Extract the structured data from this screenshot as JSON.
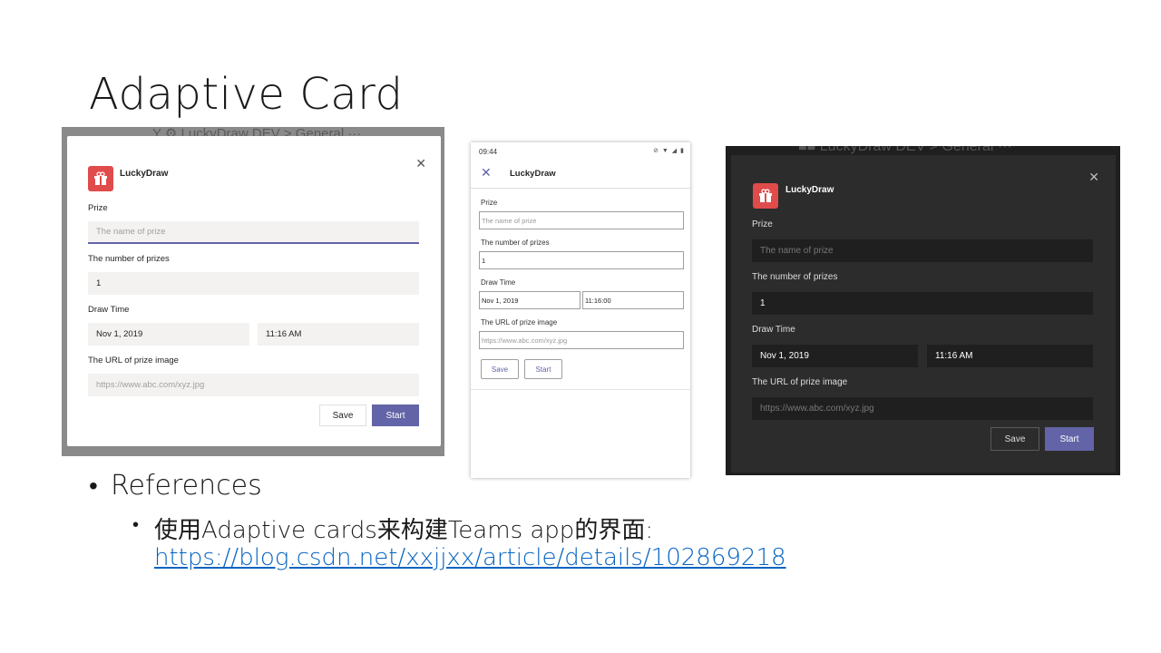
{
  "slide": {
    "title": "Adaptive Card"
  },
  "light": {
    "bg_breadcrumb": "Y   ⚙  LuckyDraw DEV  >  General ···",
    "close_glyph": "✕",
    "app_name": "LuckyDraw",
    "prize_label": "Prize",
    "prize_placeholder": "The name of prize",
    "number_label": "The number of prizes",
    "number_value": "1",
    "draw_time_label": "Draw Time",
    "date_value": "Nov 1, 2019",
    "time_value": "11:16 AM",
    "url_label": "The URL of prize image",
    "url_placeholder": "https://www.abc.com/xyz.jpg",
    "save_label": "Save",
    "start_label": "Start"
  },
  "mobile": {
    "status_time": "09:44",
    "status_icons": "⊘ ▼ ◢ ▮",
    "close_glyph": "✕",
    "app_name": "LuckyDraw",
    "prize_label": "Prize",
    "prize_placeholder": "The name of prize",
    "number_label": "The number of prizes",
    "number_value": "1",
    "draw_time_label": "Draw Time",
    "date_value": "Nov 1, 2019",
    "time_value": "11:16:00",
    "url_label": "The URL of prize image",
    "url_placeholder": "https://www.abc.com/xyz.jpg",
    "save_label": "Save",
    "start_label": "Start"
  },
  "dark": {
    "bg_breadcrumb": "■■  LuckyDraw DEV  >  General ···",
    "close_glyph": "✕",
    "app_name": "LuckyDraw",
    "prize_label": "Prize",
    "prize_placeholder": "The name of prize",
    "number_label": "The number of prizes",
    "number_value": "1",
    "draw_time_label": "Draw Time",
    "date_value": "Nov 1, 2019",
    "time_value": "11:16 AM",
    "url_label": "The URL of prize image",
    "url_placeholder": "https://www.abc.com/xyz.jpg",
    "save_label": "Save",
    "start_label": "Start"
  },
  "references": {
    "bullet": "•",
    "title": "References",
    "sub_bullet": "•",
    "item_text": "使用Adaptive cards来构建Teams app的界面:",
    "item_link": "https://blog.csdn.net/xxjjxx/article/details/102869218"
  },
  "colors": {
    "teams_purple": "#6264a7",
    "app_icon_red": "#e04b4b",
    "link_blue": "#0563c1"
  }
}
